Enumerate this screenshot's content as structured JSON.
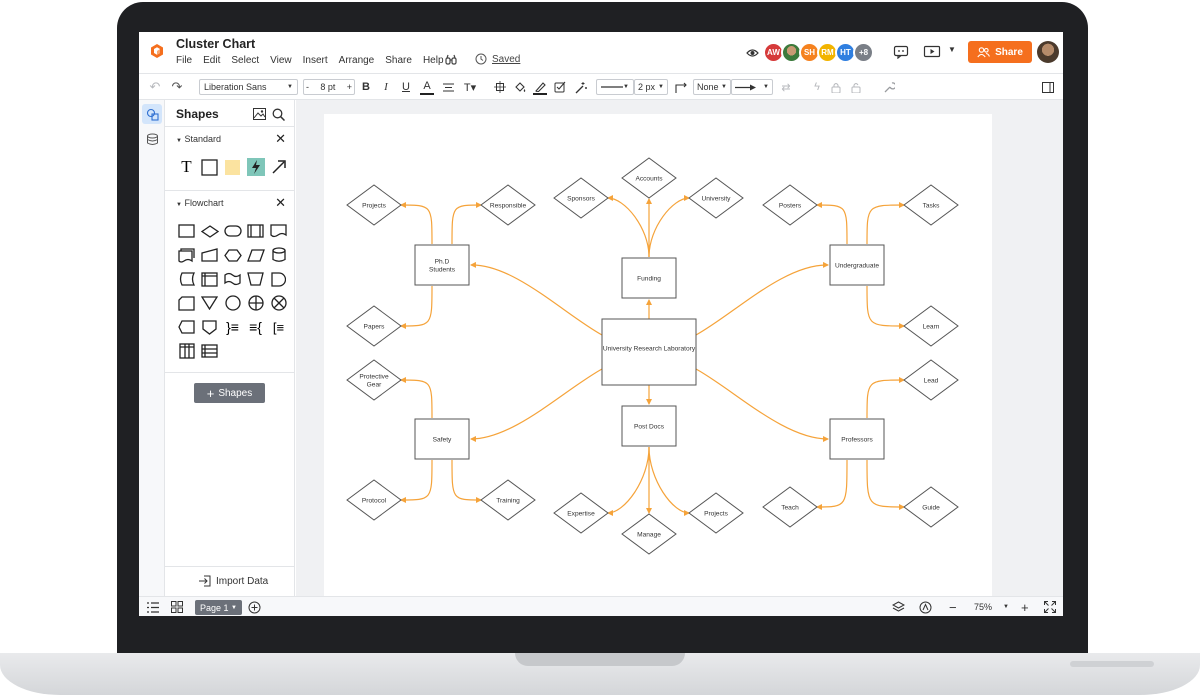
{
  "app": {
    "doc_title": "Cluster Chart",
    "menu": [
      "File",
      "Edit",
      "Select",
      "View",
      "Insert",
      "Arrange",
      "Share",
      "Help"
    ],
    "saved_label": "Saved",
    "share_label": "Share",
    "accent": "#f56f1e"
  },
  "collaborators": [
    {
      "initials": "AW",
      "color": "#d63a3a"
    },
    {
      "initials": "",
      "color": "#3c7a3c"
    },
    {
      "initials": "SH",
      "color": "#f5821f"
    },
    {
      "initials": "RM",
      "color": "#f2b400"
    },
    {
      "initials": "HT",
      "color": "#2f7fe0"
    },
    {
      "initials": "+8",
      "color": "#7a7f87"
    }
  ],
  "toolbar": {
    "font_family": "Liberation Sans",
    "font_size": "8 pt",
    "line_width": "2 px",
    "arrow_start": "None"
  },
  "shapes_panel": {
    "title": "Shapes",
    "standard_label": "Standard",
    "flowchart_label": "Flowchart",
    "add_shapes_label": "Shapes",
    "import_label": "Import Data"
  },
  "statusbar": {
    "page_label": "Page 1",
    "zoom": "75%"
  },
  "diagram": {
    "line_color": "#f5a33a",
    "center": "University Research Laboratory",
    "hubs": [
      "Ph.D Students",
      "Funding",
      "Undergraduate",
      "Safety",
      "Post Docs",
      "Professors"
    ],
    "leaves": {
      "phd": [
        "Projects",
        "Responsible",
        "Papers"
      ],
      "funding": [
        "Sponsors",
        "Accounts",
        "University"
      ],
      "undergraduate": [
        "Posters",
        "Tasks",
        "Learn"
      ],
      "safety": [
        "Protective Gear",
        "Protocol",
        "Training"
      ],
      "postdocs": [
        "Expertise",
        "Manage",
        "Projects"
      ],
      "professors": [
        "Lead",
        "Teach",
        "Guide"
      ]
    }
  }
}
